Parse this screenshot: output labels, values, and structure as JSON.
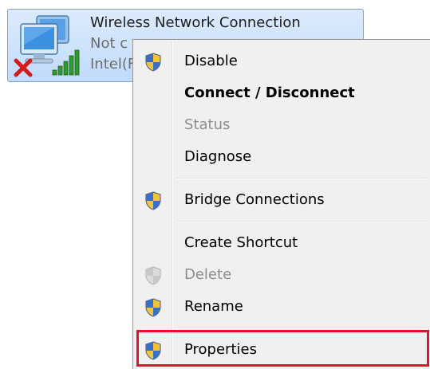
{
  "connection": {
    "name": "Wireless Network Connection",
    "status": "Not c",
    "adapter": "Intel(F",
    "icons": [
      "wireless-adapter-icon",
      "disconnected-x-icon",
      "signal-strength-icon"
    ]
  },
  "menu": {
    "items": [
      {
        "label": "Disable",
        "shield": true,
        "bold": false,
        "disabled": false
      },
      {
        "label": "Connect / Disconnect",
        "shield": false,
        "bold": true,
        "disabled": false
      },
      {
        "label": "Status",
        "shield": false,
        "bold": false,
        "disabled": true
      },
      {
        "label": "Diagnose",
        "shield": false,
        "bold": false,
        "disabled": false
      },
      {
        "label": "Bridge Connections",
        "shield": true,
        "bold": false,
        "disabled": false
      },
      {
        "label": "Create Shortcut",
        "shield": false,
        "bold": false,
        "disabled": false
      },
      {
        "label": "Delete",
        "shield": true,
        "bold": false,
        "disabled": true
      },
      {
        "label": "Rename",
        "shield": true,
        "bold": false,
        "disabled": false
      },
      {
        "label": "Properties",
        "shield": true,
        "bold": false,
        "disabled": false
      }
    ]
  },
  "colors": {
    "highlight_border": "#e0142b",
    "tile_background": "#c1dbfc",
    "menu_background": "#f0f0f0"
  }
}
